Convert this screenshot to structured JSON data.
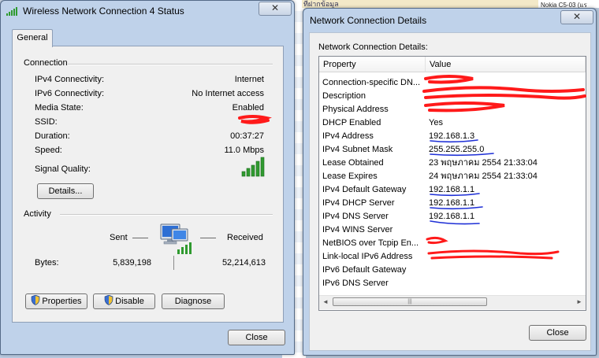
{
  "background": {
    "top_left_text": "ที่ฝากข้อมูล",
    "top_right_text": "Nokia C5-03 (แร"
  },
  "status_window": {
    "title": "Wireless Network Connection 4 Status",
    "close_glyph": "✕",
    "tab_label": "General",
    "connection": {
      "heading": "Connection",
      "rows": [
        {
          "label": "IPv4 Connectivity:",
          "value": "Internet"
        },
        {
          "label": "IPv6 Connectivity:",
          "value": "No Internet access"
        },
        {
          "label": "Media State:",
          "value": "Enabled"
        },
        {
          "label": "SSID:",
          "value": ""
        },
        {
          "label": "Duration:",
          "value": "00:37:27"
        },
        {
          "label": "Speed:",
          "value": "11.0 Mbps"
        }
      ],
      "signal_label": "Signal Quality:",
      "signal_bars": 5,
      "details_button": "Details..."
    },
    "activity": {
      "heading": "Activity",
      "sent_label": "Sent",
      "received_label": "Received",
      "bytes_label": "Bytes:",
      "bytes_sent": "5,839,198",
      "bytes_received": "52,214,613"
    },
    "buttons": {
      "properties": "Properties",
      "disable": "Disable",
      "diagnose": "Diagnose",
      "close": "Close"
    }
  },
  "details_window": {
    "title": "Network Connection Details",
    "close_glyph": "✕",
    "section_label": "Network Connection Details:",
    "columns": {
      "property": "Property",
      "value": "Value"
    },
    "rows": [
      {
        "property": "Connection-specific DN...",
        "value": ""
      },
      {
        "property": "Description",
        "value": ""
      },
      {
        "property": "Physical Address",
        "value": ""
      },
      {
        "property": "DHCP Enabled",
        "value": "Yes"
      },
      {
        "property": "IPv4 Address",
        "value": "192.168.1.3"
      },
      {
        "property": "IPv4 Subnet Mask",
        "value": "255.255.255.0"
      },
      {
        "property": "Lease Obtained",
        "value": "23 พฤษภาคม 2554 21:33:04"
      },
      {
        "property": "Lease Expires",
        "value": "24 พฤษภาคม 2554 21:33:04"
      },
      {
        "property": "IPv4 Default Gateway",
        "value": "192.168.1.1"
      },
      {
        "property": "IPv4 DHCP Server",
        "value": "192.168.1.1"
      },
      {
        "property": "IPv4 DNS Server",
        "value": "192.168.1.1"
      },
      {
        "property": "IPv4 WINS Server",
        "value": ""
      },
      {
        "property": "NetBIOS over Tcpip En...",
        "value": ""
      },
      {
        "property": "Link-local IPv6 Address",
        "value": ""
      },
      {
        "property": "IPv6 Default Gateway",
        "value": ""
      },
      {
        "property": "IPv6 DNS Server",
        "value": ""
      }
    ],
    "scroll_left": "◄",
    "scroll_right": "►",
    "scroll_thumb": "|||",
    "close_button": "Close"
  },
  "colors": {
    "redaction": "#ff1a1a",
    "underline": "#1e2fd6",
    "signal_green": "#2f9a2f"
  }
}
